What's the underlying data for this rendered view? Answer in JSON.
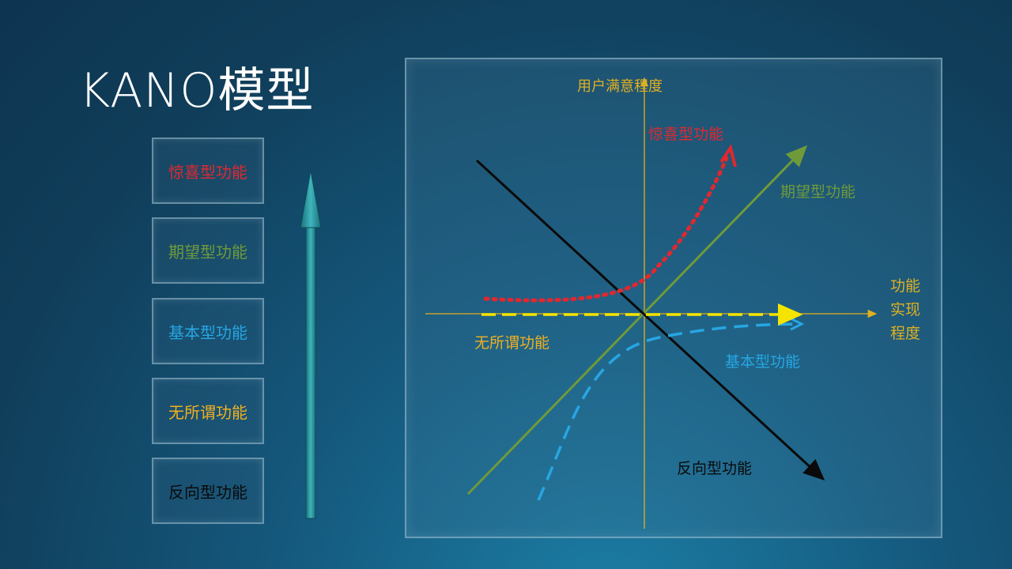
{
  "slide": {
    "title": "KANO模型"
  },
  "legend": [
    {
      "label": "惊喜型功能",
      "color": "#e0282f"
    },
    {
      "label": "期望型功能",
      "color": "#6f9a3a"
    },
    {
      "label": "基本型功能",
      "color": "#27a6e3"
    },
    {
      "label": "无所谓功能",
      "color": "#f0b020"
    },
    {
      "label": "反向型功能",
      "color": "#0a0a0a"
    }
  ],
  "diagram": {
    "y_axis_label": "用户满意程度",
    "x_axis_label_lines": [
      "功能",
      "实现",
      "程度"
    ],
    "axis_color": "#e0b020",
    "curves": {
      "delight": {
        "label": "惊喜型功能",
        "color": "#e0282f",
        "style": "dotted"
      },
      "performance": {
        "label": "期望型功能",
        "color": "#6f9a3a",
        "style": "solid"
      },
      "basic": {
        "label": "基本型功能",
        "color": "#27a6e3",
        "style": "dashed"
      },
      "indifferent": {
        "label": "无所谓功能",
        "color": "#f0b020",
        "style": "dashed"
      },
      "reverse": {
        "label": "反向型功能",
        "color": "#0a0a0a",
        "style": "solid"
      }
    }
  }
}
